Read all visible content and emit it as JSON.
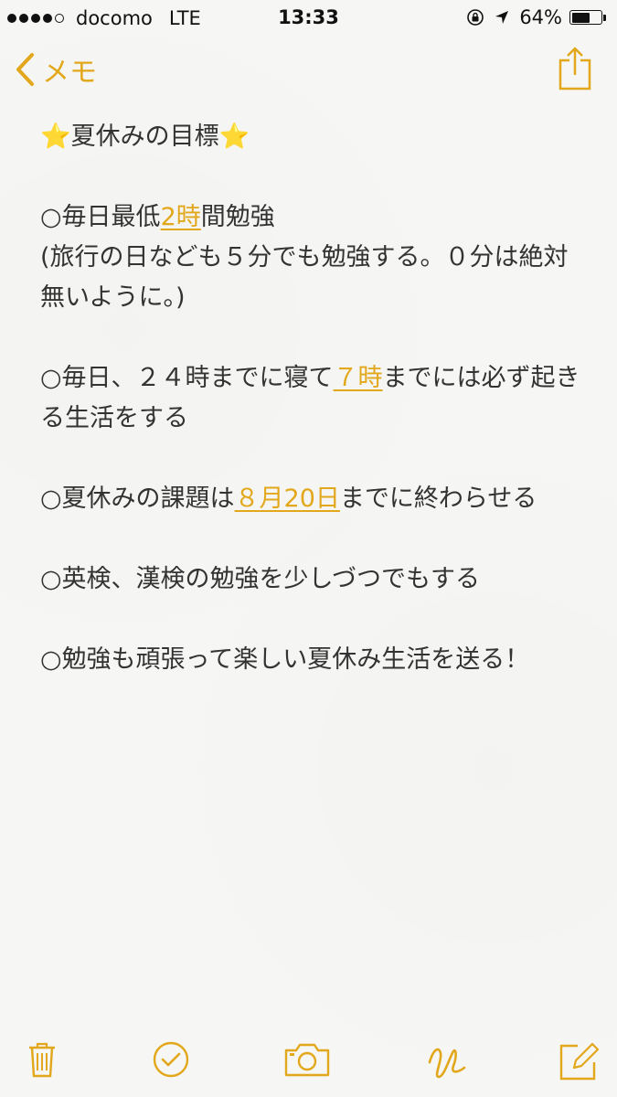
{
  "status": {
    "carrier": "docomo",
    "network": "LTE",
    "time": "13:33",
    "battery_percent_label": "64%",
    "battery_level": 0.64
  },
  "nav": {
    "back_label": "メモ",
    "accent_color": "#e2a71a"
  },
  "note": {
    "title_star_left": "⭐",
    "title_text": "夏休みの目標",
    "title_star_right": "⭐",
    "item1": {
      "prefix": "○毎日最低",
      "link": "2時",
      "suffix": "間勉強",
      "sub": "(旅行の日なども５分でも勉強する。０分は絶対無いように。)"
    },
    "item2": {
      "prefix": "○毎日、２４時までに寝て",
      "link": "７時",
      "suffix": "までには必ず起きる生活をする"
    },
    "item3": {
      "prefix": "○夏休みの課題は",
      "link": "８月20日",
      "suffix": "までに終わらせる"
    },
    "item4": "○英検、漢検の勉強を少しづつでもする",
    "item5": "○勉強も頑張って楽しい夏休み生活を送る！"
  },
  "toolbar": {
    "icons": [
      "trash-icon",
      "checklist-icon",
      "camera-icon",
      "sketch-icon",
      "compose-icon"
    ]
  }
}
